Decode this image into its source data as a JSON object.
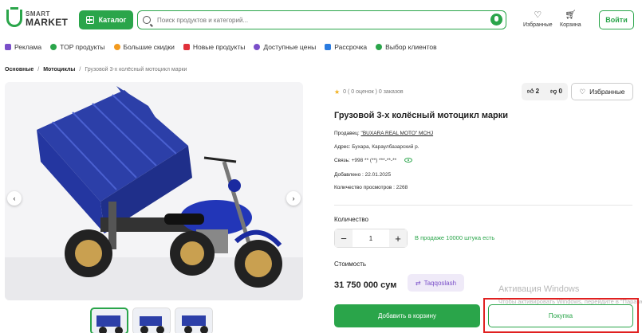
{
  "header": {
    "logo_small": "SMART",
    "logo_big": "MARKET",
    "catalog_label": "Каталог",
    "search_placeholder": "Поиск продуктов и категорий...",
    "favorites_label": "Избранные",
    "cart_label": "Корзина",
    "login_label": "Войти"
  },
  "nav": {
    "items": [
      {
        "label": "Реклама",
        "color": "#7a4fc9"
      },
      {
        "label": "TOP продукты",
        "color": "#2aa54a"
      },
      {
        "label": "Большие скидки",
        "color": "#f29a1e"
      },
      {
        "label": "Новые продукты",
        "color": "#e0303a"
      },
      {
        "label": "Доступные цены",
        "color": "#7a4fc9"
      },
      {
        "label": "Рассрочка",
        "color": "#2a7be0"
      },
      {
        "label": "Выбор клиентов",
        "color": "#2aa54a"
      }
    ]
  },
  "breadcrumb": {
    "items": [
      "Основные",
      "Мотоциклы",
      "Грузовой 3-х колёсный мотоцикл марки"
    ]
  },
  "product": {
    "rating_text": "0 ( 0 оценок ) 0 заказов",
    "likes": "2",
    "dislikes": "0",
    "favorite_label": "Избранные",
    "title": "Грузовой 3-х колёсный мотоцикл марки",
    "seller_key": "Продавец:",
    "seller_value": "\"BUXARA REAL MOTO\" MCHJ",
    "address_key": "Адрес:",
    "address_value": "Бухара, Караулбазарский р.",
    "contact_key": "Связь:",
    "contact_value": "+998 ** (**) ***-**-**",
    "added_key": "Добавлено :",
    "added_value": "22.01.2025",
    "views_key": "Количество просмотров :",
    "views_value": "2268",
    "quantity_label": "Количество",
    "quantity_value": "1",
    "stock_text": "В продаже 10000 штука есть",
    "price_label": "Стоимость",
    "price": "31 750 000 сум",
    "compare_label": "Taqqoslash",
    "add_to_cart_label": "Добавить в корзину",
    "buy_label": "Покупка"
  },
  "watermark": {
    "line1": "Активация Windows",
    "line2": "Чтобы активировать Windows, перейдите в \"Параметры\"."
  }
}
